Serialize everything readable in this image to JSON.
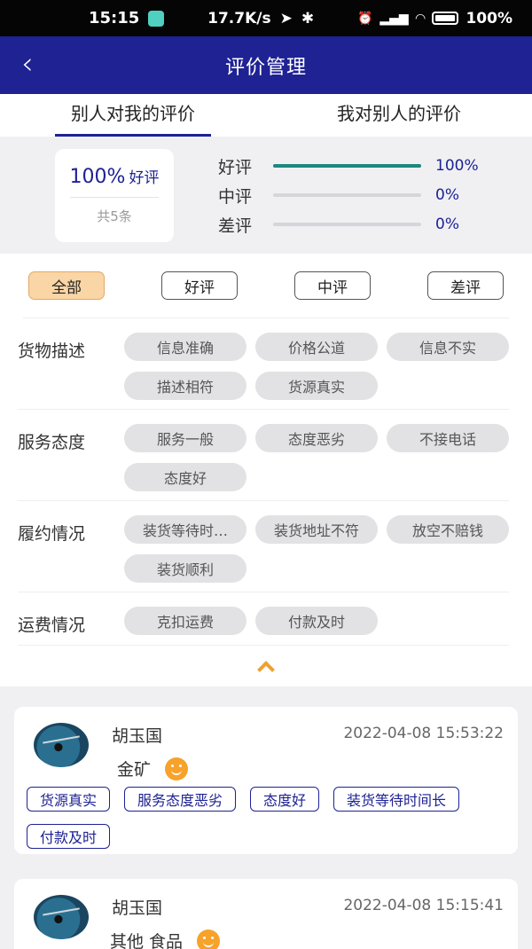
{
  "status_bar": {
    "time": "15:15",
    "speed": "17.7K/s",
    "battery": "100%"
  },
  "nav": {
    "title": "评价管理",
    "back_icon": "chevron-left-icon"
  },
  "tabs": [
    {
      "label": "别人对我的评价"
    },
    {
      "label": "我对别人的评价"
    }
  ],
  "summary": {
    "percent": "100%",
    "percent_label": "好评",
    "total": "共5条",
    "rows": [
      {
        "label": "好评",
        "value": "100%",
        "fill": 1.0
      },
      {
        "label": "中评",
        "value": "0%",
        "fill": 0
      },
      {
        "label": "差评",
        "value": "0%",
        "fill": 0
      }
    ]
  },
  "filters": [
    "全部",
    "好评",
    "中评",
    "差评"
  ],
  "categories": [
    {
      "title": "货物描述",
      "chips": [
        "信息准确",
        "价格公道",
        "信息不实",
        "描述相符",
        "货源真实"
      ]
    },
    {
      "title": "服务态度",
      "chips": [
        "服务一般",
        "态度恶劣",
        "不接电话",
        "态度好"
      ]
    },
    {
      "title": "履约情况",
      "chips": [
        "装货等待时…",
        "装货地址不符",
        "放空不赔钱",
        "装货顺利"
      ]
    },
    {
      "title": "运费情况",
      "chips": [
        "克扣运费",
        "付款及时"
      ]
    }
  ],
  "reviews": [
    {
      "name": "胡玉国",
      "date": "2022-04-08 15:53:22",
      "goods": "金矿",
      "tags": [
        "货源真实",
        "服务态度恶劣",
        "态度好",
        "装货等待时间长",
        "付款及时"
      ]
    },
    {
      "name": "胡玉国",
      "date": "2022-04-08 15:15:41",
      "goods": "其他  食品",
      "tags": []
    }
  ]
}
